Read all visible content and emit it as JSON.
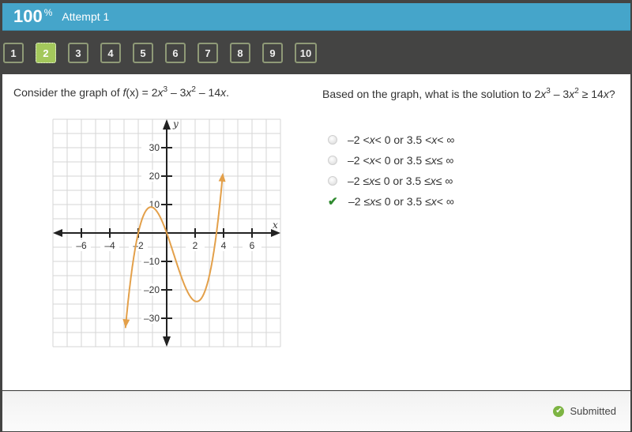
{
  "header": {
    "score": "100",
    "score_unit": "%",
    "attempt": "Attempt 1",
    "bar_color": "#45a5ca"
  },
  "question_nav": {
    "active": 2,
    "items": [
      "1",
      "2",
      "3",
      "4",
      "5",
      "6",
      "7",
      "8",
      "9",
      "10"
    ],
    "active_color": "#a4c85c"
  },
  "left": {
    "prefix": "Consider the graph of ",
    "func_name": "f",
    "func_arg": "(x)",
    "eq": " = 2",
    "x1": "x",
    "exp1": "3",
    "mid": " – 3",
    "x2": "x",
    "exp2": "2",
    "tail": " – 14",
    "x3": "x",
    "end": "."
  },
  "right": {
    "prefix": "Based on the graph, what is the solution to 2",
    "x1": "x",
    "exp1": "3",
    "mid": " – 3",
    "x2": "x",
    "exp2": "2",
    "rel": " ≥ 14",
    "x3": "x",
    "end": "?"
  },
  "options": [
    {
      "a": "–2 < ",
      "b": " < 0 or 3.5 < ",
      "c": " < ∞",
      "state": "unselected"
    },
    {
      "a": "–2 < ",
      "b": " < 0 or 3.5 ≤ ",
      "c": " ≤ ∞",
      "state": "unselected"
    },
    {
      "a": "–2 ≤ ",
      "b": " ≤ 0 or 3.5 ≤ ",
      "c": " ≤ ∞",
      "state": "unselected"
    },
    {
      "a": "–2 ≤ ",
      "b": " ≤ 0 or 3.5 ≤ ",
      "c": " < ∞",
      "state": "correct-selected"
    }
  ],
  "option_var": "x",
  "footer": {
    "status": "Submitted",
    "status_color": "#7db443"
  },
  "chart_data": {
    "type": "line",
    "title": "",
    "function": "f(x) = 2x^3 - 3x^2 - 14x",
    "xlabel": "x",
    "ylabel": "y",
    "xlim": [
      -8,
      8
    ],
    "ylim": [
      -40,
      40
    ],
    "x_grid_step": 1,
    "y_grid_step": 5,
    "grid": true,
    "x_ticks": [
      -6,
      -4,
      -2,
      2,
      4,
      6
    ],
    "x_tick_labels": [
      "–6",
      "–4",
      "–2",
      "2",
      "4",
      "6"
    ],
    "y_ticks": [
      30,
      20,
      10,
      -10,
      -20,
      -30
    ],
    "y_tick_labels": [
      "30",
      "20",
      "10",
      "–10",
      "–20",
      "–30"
    ],
    "curve_x_range": [
      -2.9,
      3.95
    ],
    "curve_color": "#e3a04a",
    "roots": [
      -2,
      0,
      3.5
    ],
    "local_max": [
      -1.15,
      9.5
    ],
    "local_min": [
      2.15,
      -23.5
    ]
  }
}
